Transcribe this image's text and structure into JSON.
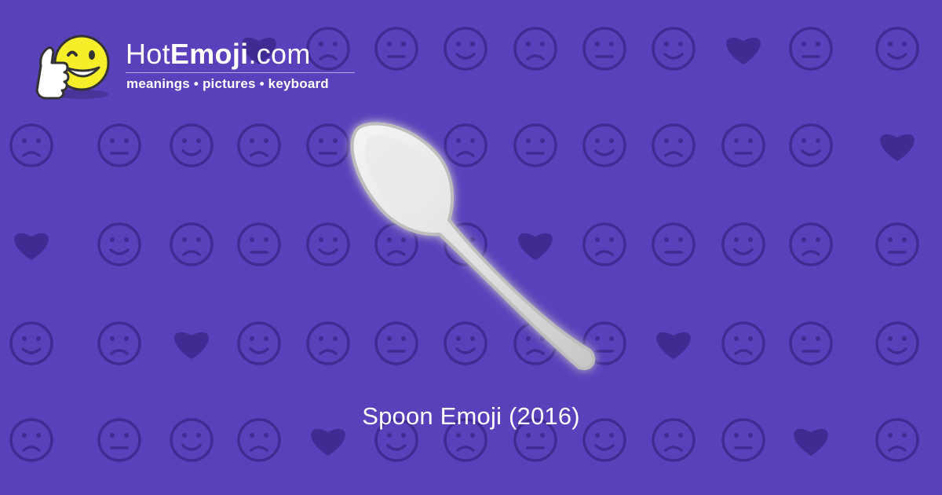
{
  "site": {
    "name_light": "Hot",
    "name_bold": "Emoji",
    "name_tld": ".com",
    "tagline": "meanings • pictures • keyboard"
  },
  "emoji": {
    "caption": "Spoon Emoji (2016)"
  },
  "icons": {
    "logo": "thumbs-up-winking-face-icon",
    "main": "spoon-icon",
    "background": "emoji-pattern-icons"
  },
  "colors": {
    "background": "#5a40bb",
    "pattern": "#3f2b92",
    "text": "#ffffff",
    "logo_face": "#f7ee2a"
  }
}
